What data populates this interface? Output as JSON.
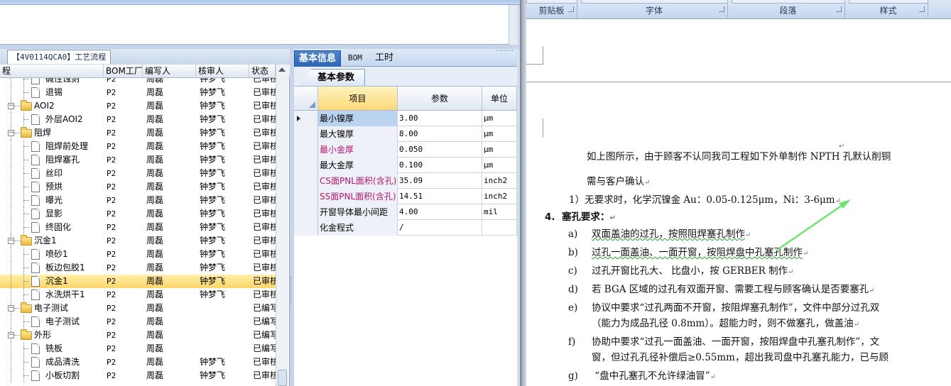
{
  "tree": {
    "tab_title": "【4V0114QCA0】工艺流程",
    "columns": [
      "程",
      "BOM工厂",
      "编写人",
      "核审人",
      "状态"
    ],
    "rows": [
      {
        "level": 2,
        "type": "doc",
        "name": "碱性蚀刻",
        "bom": "P2",
        "writer": "周磊",
        "reviewer": "钟梦飞",
        "status": "已审核"
      },
      {
        "level": 2,
        "type": "doc",
        "name": "退锡",
        "bom": "P2",
        "writer": "周磊",
        "reviewer": "钟梦飞",
        "status": "已审核"
      },
      {
        "level": 1,
        "type": "folder",
        "name": "AOI2",
        "bom": "P2",
        "writer": "周磊",
        "reviewer": "钟梦飞",
        "status": "已审核"
      },
      {
        "level": 2,
        "type": "doc",
        "name": "外层AOI2",
        "bom": "P2",
        "writer": "周磊",
        "reviewer": "钟梦飞",
        "status": "已审核"
      },
      {
        "level": 1,
        "type": "folder",
        "name": "阻焊",
        "bom": "P2",
        "writer": "周磊",
        "reviewer": "钟梦飞",
        "status": "已审核"
      },
      {
        "level": 2,
        "type": "doc",
        "name": "阻焊前处理",
        "bom": "P2",
        "writer": "周磊",
        "reviewer": "钟梦飞",
        "status": "已审核"
      },
      {
        "level": 2,
        "type": "doc",
        "name": "阻焊塞孔",
        "bom": "P2",
        "writer": "周磊",
        "reviewer": "钟梦飞",
        "status": "已审核"
      },
      {
        "level": 2,
        "type": "doc",
        "name": "丝印",
        "bom": "P2",
        "writer": "周磊",
        "reviewer": "钟梦飞",
        "status": "已审核"
      },
      {
        "level": 2,
        "type": "doc",
        "name": "预烘",
        "bom": "P2",
        "writer": "周磊",
        "reviewer": "钟梦飞",
        "status": "已审核"
      },
      {
        "level": 2,
        "type": "doc",
        "name": "曝光",
        "bom": "P2",
        "writer": "周磊",
        "reviewer": "钟梦飞",
        "status": "已审核"
      },
      {
        "level": 2,
        "type": "doc",
        "name": "显影",
        "bom": "P2",
        "writer": "周磊",
        "reviewer": "钟梦飞",
        "status": "已审核"
      },
      {
        "level": 2,
        "type": "doc",
        "name": "终固化",
        "bom": "P2",
        "writer": "周磊",
        "reviewer": "钟梦飞",
        "status": "已审核"
      },
      {
        "level": 1,
        "type": "folder",
        "name": "沉金1",
        "bom": "P2",
        "writer": "周磊",
        "reviewer": "钟梦飞",
        "status": "已审核"
      },
      {
        "level": 2,
        "type": "doc",
        "name": "喷砂1",
        "bom": "P2",
        "writer": "周磊",
        "reviewer": "钟梦飞",
        "status": "已审核"
      },
      {
        "level": 2,
        "type": "doc",
        "name": "板边包胶1",
        "bom": "P2",
        "writer": "周磊",
        "reviewer": "钟梦飞",
        "status": "已审核"
      },
      {
        "level": 2,
        "type": "doc",
        "name": "沉金1",
        "bom": "P2",
        "writer": "周磊",
        "reviewer": "钟梦飞",
        "status": "已审核",
        "selected": true
      },
      {
        "level": 2,
        "type": "doc",
        "name": "水洗烘干1",
        "bom": "P2",
        "writer": "周磊",
        "reviewer": "钟梦飞",
        "status": "已审核"
      },
      {
        "level": 1,
        "type": "folder",
        "name": "电子测试",
        "bom": "P2",
        "writer": "周磊",
        "reviewer": "",
        "status": "已编写"
      },
      {
        "level": 2,
        "type": "doc",
        "name": "电子测试",
        "bom": "P2",
        "writer": "周磊",
        "reviewer": "",
        "status": "已编写"
      },
      {
        "level": 1,
        "type": "folder",
        "name": "外形",
        "bom": "P2",
        "writer": "周磊",
        "reviewer": "",
        "status": "已编写"
      },
      {
        "level": 2,
        "type": "doc",
        "name": "铣板",
        "bom": "P2",
        "writer": "周磊",
        "reviewer": "",
        "status": "已编写"
      },
      {
        "level": 2,
        "type": "doc",
        "name": "成品清洗",
        "bom": "P2",
        "writer": "周磊",
        "reviewer": "钟梦飞",
        "status": "已审核"
      },
      {
        "level": 2,
        "type": "doc",
        "name": "小板切割",
        "bom": "P2",
        "writer": "周磊",
        "reviewer": "钟梦飞",
        "status": "已审核"
      }
    ]
  },
  "params": {
    "tabs": [
      "基本信息",
      "BOM",
      "工时"
    ],
    "subtab": "基本参数",
    "columns": [
      "项目",
      "参数",
      "单位"
    ],
    "rows": [
      {
        "item": "最小镍厚",
        "value": "3.00",
        "unit": "μm",
        "current": true
      },
      {
        "item": "最大镍厚",
        "value": "8.00",
        "unit": "μm"
      },
      {
        "item": "最小金厚",
        "value": "0.050",
        "unit": "μm",
        "pink": true
      },
      {
        "item": "最大金厚",
        "value": "0.100",
        "unit": "μm"
      },
      {
        "item": "CS面PNL面积(含孔)",
        "value": "35.09",
        "unit": "inch2",
        "pink": true
      },
      {
        "item": "SS面PNL面积(含孔)",
        "value": "14.51",
        "unit": "inch2",
        "pink": true
      },
      {
        "item": "开窗导体最小间距",
        "value": "4.00",
        "unit": "mil"
      },
      {
        "item": "化金程式",
        "value": "/",
        "unit": ""
      }
    ]
  },
  "ribbon": {
    "groups": [
      "剪贴板",
      "字体",
      "段落",
      "样式"
    ]
  },
  "document": {
    "p1_line1": "如上图所示，由于顾客不认同我司工程如下外单制作 NPTH 孔默认削铜",
    "p1_line2": "需与客户确认",
    "item1": "1）无要求时，化学沉镍金 Au：0.05-0.125μm，Ni：3-6μm",
    "heading_num": "4.",
    "heading": "塞孔要求：",
    "list": [
      {
        "mark": "a)",
        "text": "双面盖油的过孔，按照阻焊塞孔制作"
      },
      {
        "mark": "b)",
        "text": "过孔一面盖油、一面开窗，按阻焊盘中孔塞孔制作"
      },
      {
        "mark": "c)",
        "text": "过孔开窗比孔大、 比盘小，按 GERBER 制作"
      },
      {
        "mark": "d)",
        "text": "若 BGA 区域的过孔有双面开窗、需要工程与顾客确认是否要塞孔"
      },
      {
        "mark": "e)",
        "text": "协议中要求“过孔两面不开窗，按阻焊塞孔制作”，文件中部分过孔双",
        "cont": "（能力为成品孔径 0.8mm）。超能力时，则不做塞孔，做盖油"
      },
      {
        "mark": "f)",
        "text": "协助中要求“过孔一面盖油、一面开窗，按阻焊盘中孔塞孔制作”，文",
        "cont": "窗，但过孔孔径补偿后≥0.55mm，超出我司盘中孔塞孔能力，已与顾"
      },
      {
        "mark": "g)",
        "text": " “盘中孔塞孔不允许绿油冒”"
      }
    ]
  },
  "colors": {
    "selection": "#fdd56a",
    "accent_blue": "#2a64b2",
    "annotation_arrow": "#6fe36f",
    "pink_text": "#b2156e"
  }
}
